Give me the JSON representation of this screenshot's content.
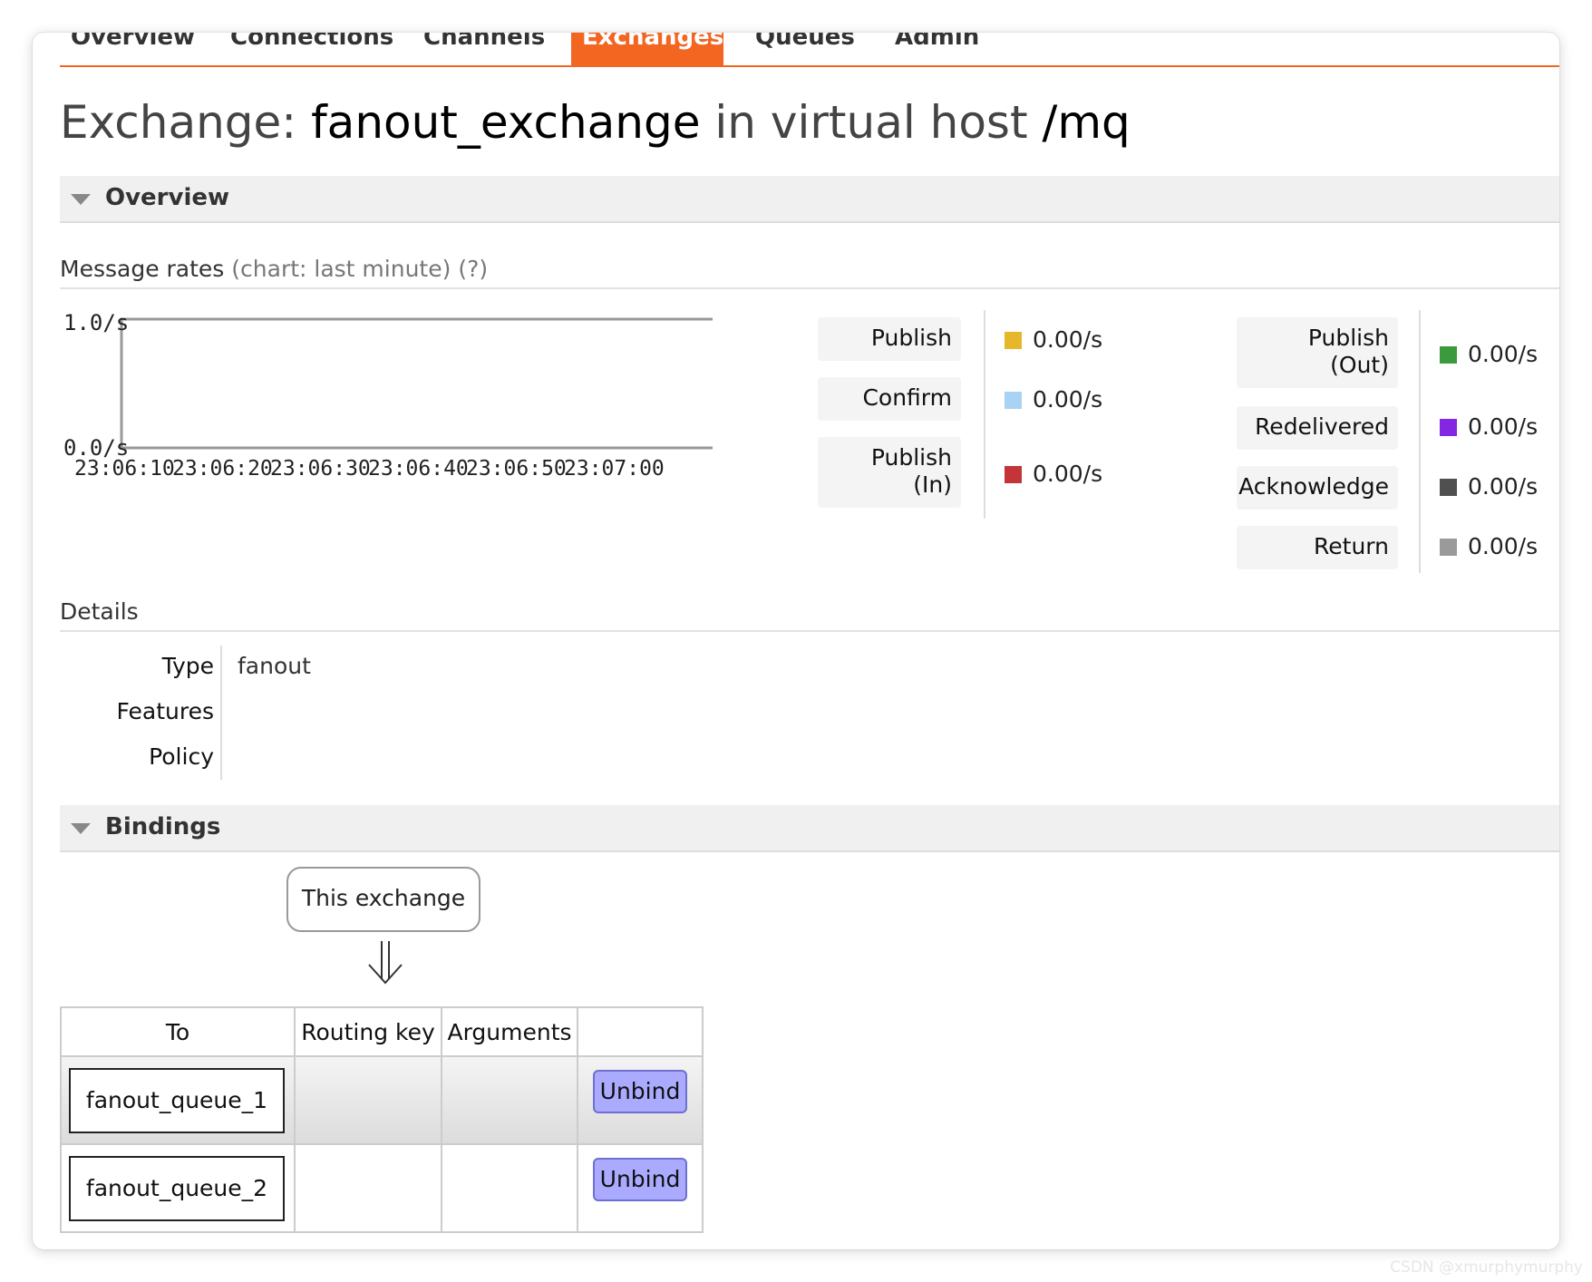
{
  "nav": {
    "items": [
      {
        "label": "Overview",
        "active": false
      },
      {
        "label": "Connections",
        "active": false
      },
      {
        "label": "Channels",
        "active": false
      },
      {
        "label": "Exchanges",
        "active": true
      },
      {
        "label": "Queues",
        "active": false
      },
      {
        "label": "Admin",
        "active": false
      }
    ],
    "accent_color": "#f26622"
  },
  "title": {
    "prefix": "Exchange:",
    "name": "fanout_exchange",
    "middle": "in virtual host",
    "vhost": "/mq"
  },
  "overview": {
    "header": "Overview",
    "message_rates": {
      "label": "Message rates",
      "chart_note": "(chart: last minute)",
      "help": "(?)"
    }
  },
  "chart_data": {
    "type": "line",
    "title": "",
    "xlabel": "",
    "ylabel": "",
    "ytick_labels": [
      "1.0/s",
      "0.0/s"
    ],
    "ylim": [
      0,
      1
    ],
    "x_tick_labels": [
      "23:06:10",
      "23:06:20",
      "23:06:30",
      "23:06:40",
      "23:06:50",
      "23:07:00"
    ],
    "series": []
  },
  "legend": {
    "left": [
      {
        "label": "Publish",
        "color": "#e6b729",
        "value": "0.00/s"
      },
      {
        "label": "Confirm",
        "color": "#a9d3f4",
        "value": "0.00/s"
      },
      {
        "label": "Publish (In)",
        "color": "#c33538",
        "value": "0.00/s"
      }
    ],
    "right": [
      {
        "label": "Publish (Out)",
        "color": "#3b9b3c",
        "value": "0.00/s"
      },
      {
        "label": "Redelivered",
        "color": "#8427e2",
        "value": "0.00/s"
      },
      {
        "label": "Acknowledge",
        "color": "#505050",
        "value": "0.00/s"
      },
      {
        "label": "Return",
        "color": "#9a9a9a",
        "value": "0.00/s"
      }
    ]
  },
  "details": {
    "heading": "Details",
    "rows": [
      {
        "key": "Type",
        "value": "fanout"
      },
      {
        "key": "Features",
        "value": ""
      },
      {
        "key": "Policy",
        "value": ""
      }
    ]
  },
  "bindings": {
    "header": "Bindings",
    "source_label": "This exchange",
    "columns": [
      "To",
      "Routing key",
      "Arguments",
      ""
    ],
    "rows": [
      {
        "to": "fanout_queue_1",
        "routing_key": "",
        "arguments": "",
        "action": "Unbind"
      },
      {
        "to": "fanout_queue_2",
        "routing_key": "",
        "arguments": "",
        "action": "Unbind"
      }
    ]
  },
  "watermark": "CSDN @xmurphymurphy"
}
